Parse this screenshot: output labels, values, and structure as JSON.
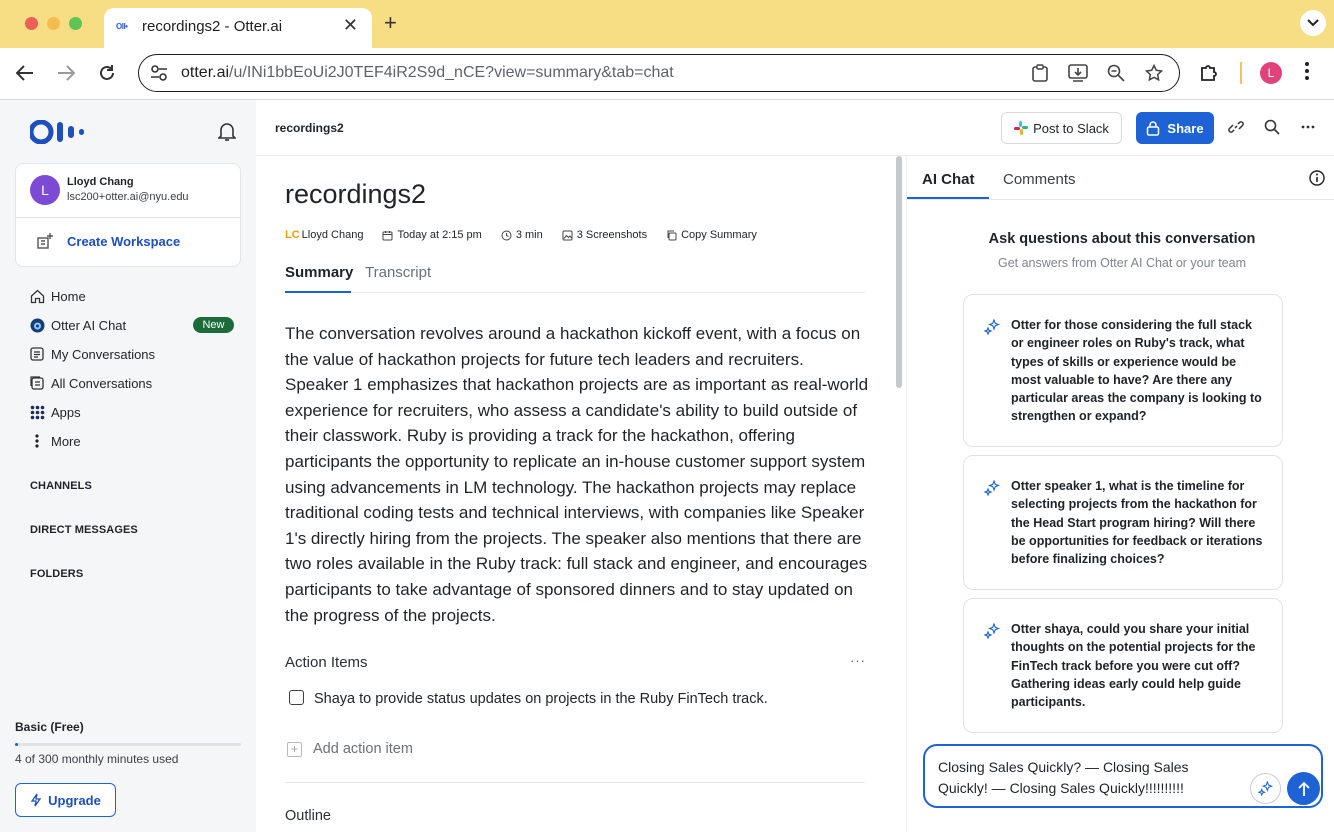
{
  "browser": {
    "tab_title": "recordings2 - Otter.ai",
    "tab_favicon_text": "Oll•",
    "url_host": "otter.ai",
    "url_path": "/u/INi1bbEoUi2J0TEF4iR2S9d_nCE?view=summary&tab=chat",
    "profile_initial": "L"
  },
  "sidebar": {
    "user": {
      "initial": "L",
      "name": "Lloyd Chang",
      "email": "lsc200+otter.ai@nyu.edu"
    },
    "create_workspace": "Create Workspace",
    "nav": [
      {
        "label": "Home",
        "icon": "home-icon"
      },
      {
        "label": "Otter AI Chat",
        "icon": "otter-chat-icon",
        "badge": "New"
      },
      {
        "label": "My Conversations",
        "icon": "conversation-icon"
      },
      {
        "label": "All Conversations",
        "icon": "all-conversations-icon"
      },
      {
        "label": "Apps",
        "icon": "apps-grid-icon"
      },
      {
        "label": "More",
        "icon": "more-vertical-icon"
      }
    ],
    "sections": [
      "CHANNELS",
      "DIRECT MESSAGES",
      "FOLDERS"
    ],
    "plan": {
      "name": "Basic (Free)",
      "usage_text": "4 of 300 monthly minutes used",
      "usage_fraction": 0.0133,
      "upgrade_label": "Upgrade"
    }
  },
  "header": {
    "breadcrumb": "recordings2",
    "post_to_slack": "Post to Slack",
    "share": "Share"
  },
  "document": {
    "title": "recordings2",
    "meta": {
      "owner_initials": "LC",
      "owner_name": "Lloyd Chang",
      "date": "Today at 2:15 pm",
      "duration": "3 min",
      "screenshots": "3 Screenshots",
      "copy_summary": "Copy Summary"
    },
    "tabs": {
      "summary": "Summary",
      "transcript": "Transcript"
    },
    "summary": "The conversation revolves around a hackathon kickoff event, with a focus on the value of hackathon projects for future tech leaders and recruiters. Speaker 1 emphasizes that hackathon projects are as important as real-world experience for recruiters, who assess a candidate's ability to build outside of their classwork. Ruby is providing a track for the hackathon, offering participants the opportunity to replicate an in-house customer support system using advancements in LM technology. The hackathon projects may replace traditional coding tests and technical interviews, with companies like Speaker 1's directly hiring from the projects. The speaker also mentions that there are two roles available in the Ruby track: full stack and engineer, and encourages participants to take advantage of sponsored dinners and to stay updated on the progress of the projects.",
    "action_items_heading": "Action Items",
    "action_items": [
      {
        "text": "Shaya to provide status updates on projects in the Ruby FinTech track.",
        "checked": false
      }
    ],
    "add_action_item": "Add action item",
    "outline_heading": "Outline"
  },
  "right_panel": {
    "tabs": {
      "ai_chat": "AI Chat",
      "comments": "Comments"
    },
    "ask_heading": "Ask questions about this conversation",
    "ask_sub": "Get answers from Otter AI Chat or your team",
    "suggestions": [
      "Otter for those considering the full stack or engineer roles on Ruby's track, what types of skills or experience would be most valuable to have? Are there any particular areas the company is looking to strengthen or expand?",
      "Otter speaker 1, what is the timeline for selecting projects from the hackathon for the Head Start program hiring? Will there be opportunities for feedback or iterations before finalizing choices?",
      "Otter shaya, could you share your initial thoughts on the potential projects for the FinTech track before you were cut off? Gathering ideas early could help guide participants."
    ],
    "chat_input_value": "Closing Sales Quickly? — Closing Sales Quickly! — Closing Sales Quickly!!!!!!!!!!"
  },
  "colors": {
    "accent": "#1d63d6",
    "tabbar": "#f7dd84",
    "new_badge": "#1d6b3a"
  }
}
